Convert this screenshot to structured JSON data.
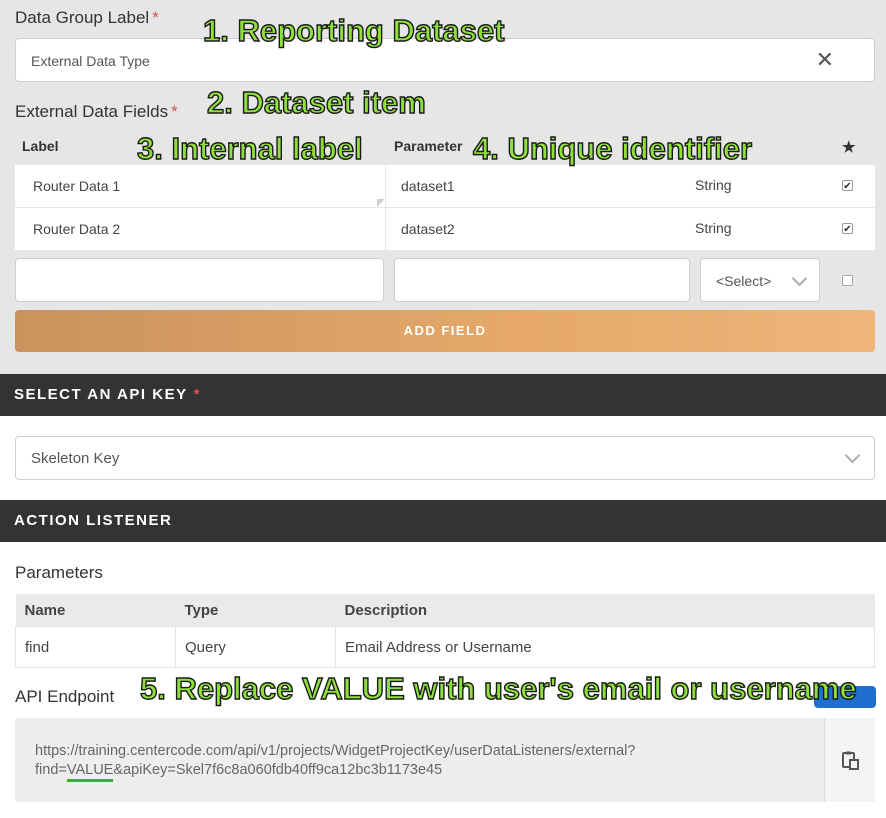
{
  "data_group": {
    "label": "Data Group Label",
    "required": "*",
    "value": "External Data Type",
    "clear_icon": "close-icon"
  },
  "fields": {
    "label": "External Data Fields",
    "required": "*",
    "columns": {
      "label": "Label",
      "parameter": "Parameter",
      "star": "★"
    },
    "rows": [
      {
        "label": "Router Data 1",
        "parameter": "dataset1",
        "type": "String",
        "checked": "✔"
      },
      {
        "label": "Router Data 2",
        "parameter": "dataset2",
        "type": "String",
        "checked": "✔"
      }
    ],
    "new_row": {
      "label_placeholder": "",
      "parameter_placeholder": "",
      "type_select": "<Select>"
    },
    "add_button": "ADD FIELD"
  },
  "api_key": {
    "section_title": "SELECT AN API KEY",
    "required": "*",
    "selected": "Skeleton Key"
  },
  "action_listener": {
    "section_title": "ACTION LISTENER",
    "parameters_title": "Parameters",
    "table": {
      "headers": [
        "Name",
        "Type",
        "Description"
      ],
      "rows": [
        [
          "find",
          "Query",
          "Email Address or Username"
        ]
      ]
    },
    "endpoint_title": "API Endpoint",
    "endpoint_line1": "https://training.centercode.com/api/v1/projects/WidgetProjectKey/userDataListeners/external?",
    "endpoint_prefix": "find=",
    "endpoint_value": "VALUE",
    "endpoint_suffix": "&apiKey=Skel7f6c8a060fdb40ff9ca12bc3b1173e45",
    "copy_icon": "clipboard-icon"
  },
  "annotations": {
    "a1": "1. Reporting Dataset",
    "a2": "2. Dataset item",
    "a3": "3. Internal label",
    "a4": "4. Unique identifier",
    "a5": "5. Replace VALUE with user's email or username",
    "color": "#8ee03c"
  },
  "colors": {
    "section_bar": "#333333",
    "required": "#d9534f",
    "add_button": "#e6a96a",
    "underline": "#3db51a"
  }
}
